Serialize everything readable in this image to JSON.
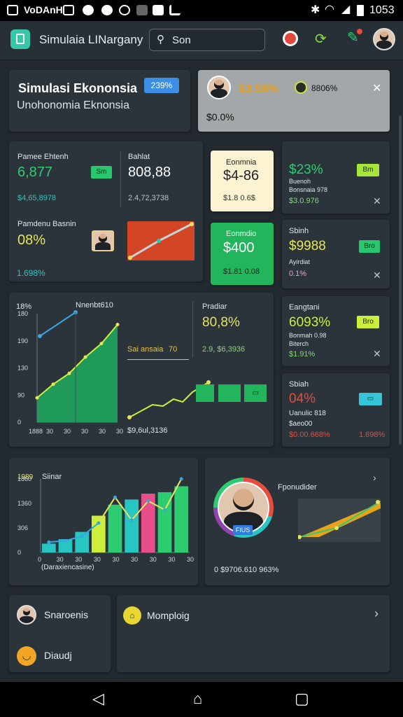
{
  "status_bar": {
    "carrier": "VoDAnH",
    "time": "1053"
  },
  "app_bar": {
    "title": "Simulaia LINargany",
    "search_value": "Son"
  },
  "header_card": {
    "title": "Simulasi Ekononsia",
    "subtitle": "Unohonomia Eknonsia",
    "badge": "239%"
  },
  "top_alert": {
    "value": "$3.56%",
    "coin_label": "8806%",
    "sub": "$0.0%"
  },
  "metric_1": {
    "label": "Pamee Ehtenh",
    "value": "6,877",
    "button": "Sm",
    "foot": "$4,65,8978"
  },
  "metric_2": {
    "label": "Bahlat",
    "value": "808,88",
    "foot": "2.4,72,3738"
  },
  "card_cream": {
    "label": "Eonmnia",
    "value": "$4-86",
    "foot": "$1.8 0.6$"
  },
  "card_green": {
    "label": "Eonmdio",
    "value": "$400",
    "foot": "$1.81 0.08"
  },
  "right_1": {
    "value": "$23%",
    "sub": "Buenoh",
    "sub2": "Bonsnaia 978",
    "foot": "$3.0.976",
    "button": "Bm"
  },
  "right_2": {
    "label": "Sbinh",
    "value": "$9988",
    "sub": "Ayirdiat",
    "foot": "0.1%",
    "button": "Bro"
  },
  "right_3": {
    "label": "Eangtani",
    "value": "6093%",
    "sub": "Bonmah 0.98",
    "sub2": "Biterch",
    "foot": "$1.91%",
    "button": "Bro"
  },
  "right_4": {
    "label": "Sbiah",
    "value": "04%",
    "sub": "Uanulic 818",
    "sub2": "$aeo00",
    "foot": "$0.00.668%",
    "foot2": "1.698%"
  },
  "mid_left": {
    "label": "Pamdenu Basnin",
    "value": "08%"
  },
  "line_chart": {
    "tag": "18%",
    "title": "Nnenbt610",
    "y_ticks": [
      "180",
      "190",
      "130",
      "90",
      "0"
    ],
    "x_ticks": [
      "1888",
      "30",
      "30",
      "30",
      "30",
      "30"
    ],
    "y_values": [
      18,
      28,
      36,
      48,
      58,
      72
    ]
  },
  "mini_chart": {
    "label": "Pradiar",
    "value": "80,8%",
    "legend": "Sai ansaia",
    "legend_num": "70",
    "stat": "2.9, $6,3936",
    "foot": "$9,6ul,3136"
  },
  "bottom_chart": {
    "tag": "1989",
    "title": "Siinar",
    "y_ticks": [
      "1860",
      "1360",
      "306",
      "0"
    ],
    "x_ticks": [
      "0",
      "30",
      "30",
      "30",
      "30",
      "30",
      "30",
      "30",
      "30"
    ],
    "xlabel": "(Daraxiencasine)",
    "values": [
      12,
      18,
      28,
      50,
      65,
      72,
      80,
      82,
      90
    ],
    "line": [
      14,
      16,
      22,
      40,
      75,
      44,
      70,
      58,
      100
    ]
  },
  "profile_card": {
    "title": "Fponudider",
    "badge": "FIUS",
    "foot": "0 $9706.610 963%"
  },
  "bottom_menu": {
    "item_1": "Snaroenis",
    "item_2": "Diaudj",
    "item_3": "Momploig"
  }
}
